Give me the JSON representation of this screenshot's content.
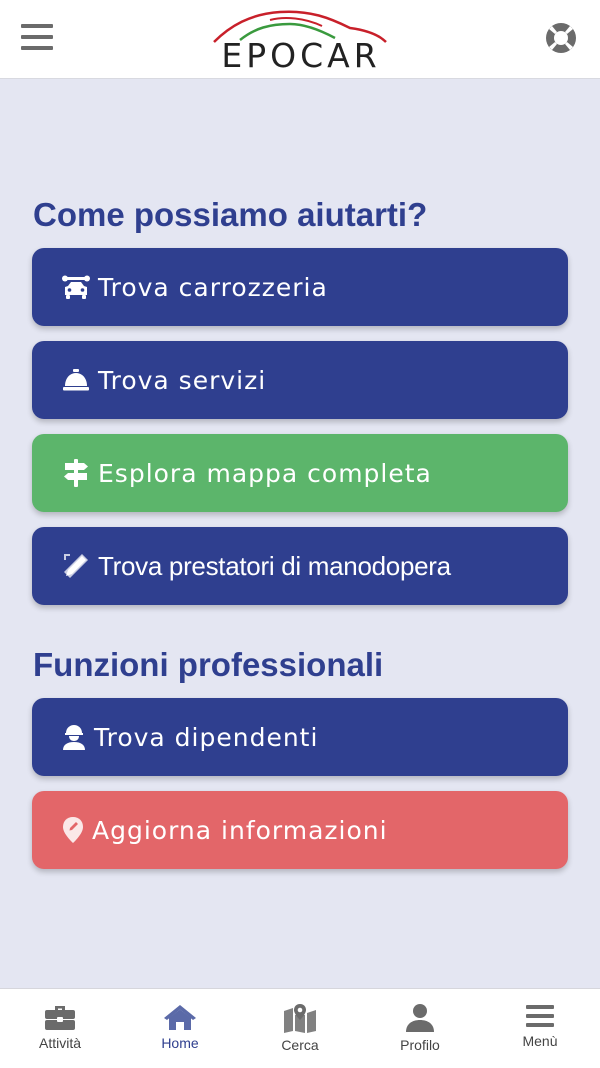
{
  "header": {
    "logo_text": "EPOCAR",
    "menu_icon": "hamburger-icon",
    "help_icon": "lifebuoy-icon"
  },
  "help_section": {
    "title": "Come possiamo aiutarti?",
    "buttons": [
      {
        "label": "Trova carrozzeria",
        "icon": "car-wrench-icon",
        "color": "#2f3f8f"
      },
      {
        "label": "Trova servizi",
        "icon": "concierge-bell-icon",
        "color": "#2f3f8f"
      },
      {
        "label": "Esplora mappa completa",
        "icon": "signpost-icon",
        "color": "#5cb56b"
      },
      {
        "label": "Trova prestatori di manodopera",
        "icon": "pencil-ruler-icon",
        "color": "#2f3f8f"
      }
    ]
  },
  "pro_section": {
    "title": "Funzioni professionali",
    "buttons": [
      {
        "label": "Trova dipendenti",
        "icon": "hard-hat-worker-icon",
        "color": "#2f3f8f"
      },
      {
        "label": "Aggiorna informazioni",
        "icon": "map-pin-edit-icon",
        "color": "#e36669"
      }
    ]
  },
  "bottom_nav": {
    "items": [
      {
        "label": "Attività",
        "icon": "briefcase-icon"
      },
      {
        "label": "Home",
        "icon": "home-icon",
        "active": true
      },
      {
        "label": "Cerca",
        "icon": "map-marker-icon"
      },
      {
        "label": "Profilo",
        "icon": "user-icon"
      },
      {
        "label": "Menù",
        "icon": "bars-icon"
      }
    ]
  }
}
